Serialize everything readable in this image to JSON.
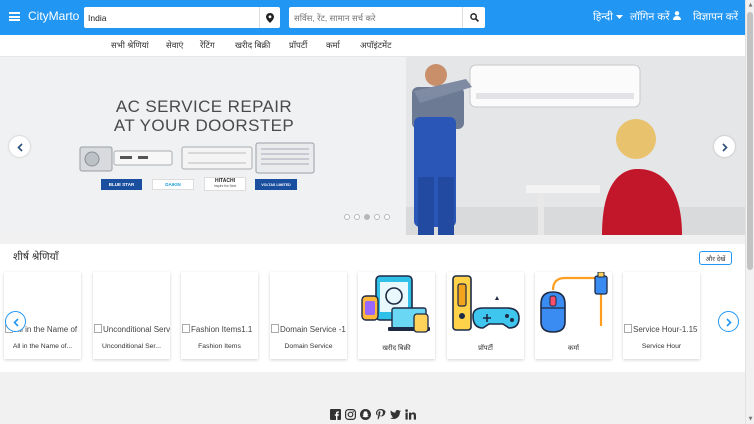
{
  "header": {
    "brand": "CityMarto",
    "location_value": "India",
    "search_placeholder": "सर्विस, रेंट, सामान सर्च करे",
    "language": "हिन्दी",
    "login": "लॉगिन करें",
    "post_ad": "विज्ञापन करें",
    "colors": {
      "bar": "#2196f3",
      "text": "#ffffff"
    }
  },
  "nav": {
    "items": [
      "सभी श्रेणियां",
      "सेवाएं",
      "रेंटिंग",
      "खरीद बिक्री",
      "प्रॉपर्टी",
      "कर्मा",
      "अपॉइंटमेंट"
    ]
  },
  "banner": {
    "headline_1": "AC SERVICE REPAIR",
    "headline_2": "AT YOUR DOORSTEP",
    "logos": [
      "BLUE STAR",
      "DAIKIN",
      "HITACHI",
      "VOLTAS LIMITED"
    ],
    "hitachi_tagline": "Inspire the Next",
    "slide_count": 5,
    "active_slide": 3
  },
  "categories": {
    "title": "शीर्ष श्रेणियाँ",
    "more_button": "और देखें",
    "cards": [
      {
        "alt": "All in the Name of",
        "caption": "All in the Name of...",
        "icon": "broken-image-icon"
      },
      {
        "alt": "Unconditional Serv",
        "caption": "Unconditional Ser...",
        "icon": "broken-image-icon"
      },
      {
        "alt": "Fashion Items1.1",
        "caption": "Fashion Items",
        "icon": "broken-image-icon"
      },
      {
        "alt": "Domain Service -1",
        "caption": "Domain Service",
        "icon": "broken-image-icon"
      },
      {
        "alt": "",
        "caption": "खरीद बिक्री",
        "icon": "devices-icon"
      },
      {
        "alt": "",
        "caption": "प्रॉपर्टी",
        "icon": "gaming-icon"
      },
      {
        "alt": "",
        "caption": "कर्मा",
        "icon": "mouse-usb-icon"
      },
      {
        "alt": "Service Hour-1.15",
        "caption": "Service Hour",
        "icon": "broken-image-icon"
      }
    ]
  },
  "social": [
    "facebook-icon",
    "instagram-icon",
    "snapchat-icon",
    "pinterest-icon",
    "twitter-icon",
    "linkedin-icon"
  ]
}
